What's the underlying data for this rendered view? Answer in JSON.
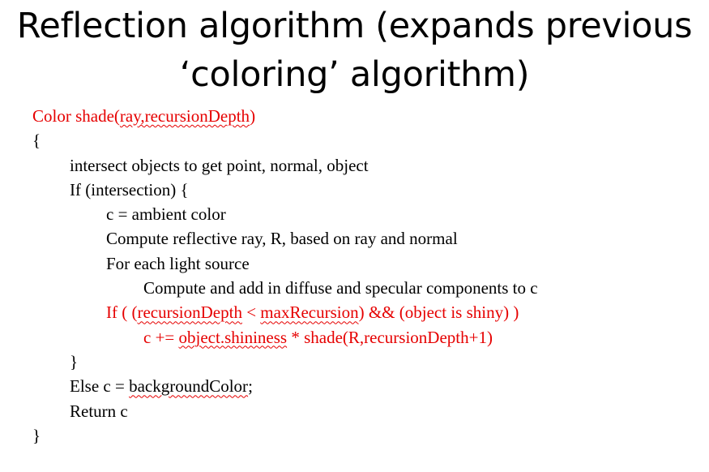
{
  "slide": {
    "title_line1": "Reflection algorithm (expands previous",
    "title_line2": "‘coloring’ algorithm)"
  },
  "code": {
    "l1_pre": "Color shade(",
    "l1_sq": "ray,recursionDepth",
    "l1_post": ")",
    "l2": "{",
    "l3": "intersect objects to get point, normal, object",
    "l4": "If (intersection) {",
    "l5": "c = ambient color",
    "l6": "Compute reflective ray, R, based on ray and normal",
    "l7": "For each light source",
    "l8": "Compute and add in diffuse and specular components to c",
    "l9_a": "If ( (",
    "l9_b": "recursionDepth",
    "l9_c": " < ",
    "l9_d": "maxRecursion",
    "l9_e": ") && (object is shiny) )",
    "l10_a": "c += ",
    "l10_b": "object.shininess",
    "l10_c": " * shade(R,recursionDepth+1)",
    "l11": "}",
    "l12_a": "Else c = ",
    "l12_b": "backgroundColor",
    "l12_c": ";",
    "l13": "Return c",
    "l14": "}"
  },
  "colors": {
    "highlight": "#e60000",
    "text": "#000000",
    "background": "#ffffff"
  }
}
